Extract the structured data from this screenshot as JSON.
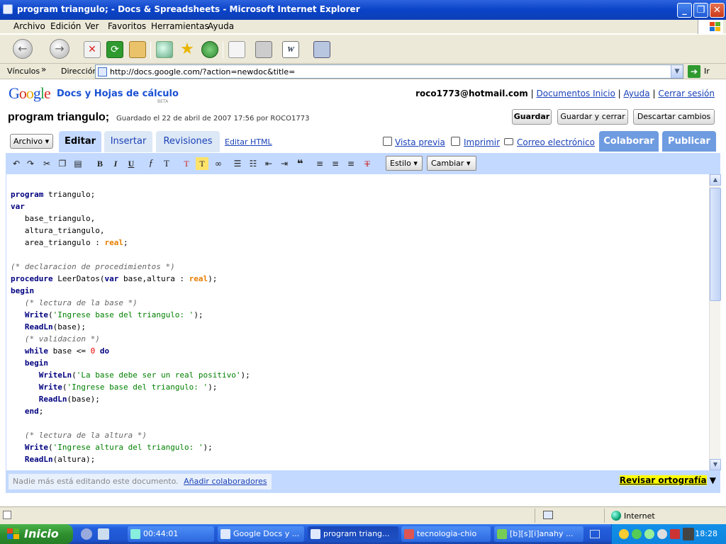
{
  "window": {
    "title": "program triangulo; - Docs & Spreadsheets - Microsoft Internet Explorer",
    "controls": {
      "minimize": "_",
      "restore": "❐",
      "close": "✕"
    }
  },
  "menu": [
    "Archivo",
    "Edición",
    "Ver",
    "Favoritos",
    "Herramientas",
    "Ayuda"
  ],
  "toolbar_icons": [
    "back-icon",
    "forward-icon",
    "stop-icon",
    "refresh-icon",
    "home-icon",
    "search-icon",
    "favorites-icon",
    "history-icon",
    "mail-icon",
    "print-icon",
    "word-icon",
    "research-icon"
  ],
  "address": {
    "links_label": "Vínculos",
    "chevron": "»",
    "label": "Dirección",
    "url": "http://docs.google.com/?action=newdoc&title=",
    "go_label": "Ir"
  },
  "app": {
    "logo": {
      "g1": "G",
      "o1": "o",
      "o2": "o",
      "g2": "g",
      "l": "l",
      "e": "e"
    },
    "product": "Docs y Hojas de cálculo",
    "beta": "BETA",
    "user_email": "roco1773@hotmail.com",
    "links": [
      "Documentos Inicio",
      "Ayuda",
      "Cerrar sesión"
    ],
    "separator": "|"
  },
  "doc": {
    "title": "program triangulo;",
    "saved": "Guardado el 22 de abril de 2007 17:56 por ROCO1773",
    "buttons": {
      "save": "Guardar",
      "save_close": "Guardar y cerrar",
      "discard": "Descartar cambios"
    }
  },
  "tabs": {
    "archivo": "Archivo",
    "editar": "Editar",
    "insertar": "Insertar",
    "revisiones": "Revisiones",
    "editar_html": "Editar HTML",
    "vista_previa": "Vista previa",
    "imprimir": "Imprimir",
    "correo": "Correo electrónico",
    "colaborar": "Colaborar",
    "publicar": "Publicar"
  },
  "format_toolbar": {
    "icons": [
      "undo-icon",
      "redo-icon",
      "cut-icon",
      "copy-icon",
      "paste-icon",
      "bold-icon",
      "italic-icon",
      "underline-icon",
      "font-icon",
      "font-size-icon",
      "text-color-icon",
      "highlight-icon",
      "link-icon",
      "numbered-list-icon",
      "bullet-list-icon",
      "outdent-icon",
      "indent-icon",
      "quote-icon",
      "align-left-icon",
      "align-center-icon",
      "align-right-icon",
      "clear-format-icon"
    ],
    "glyphs": {
      "bold": "B",
      "italic": "I",
      "underline": "U"
    },
    "style": "Estilo",
    "change": "Cambiar"
  },
  "code": {
    "l1a": "program",
    "l1b": " triangulo;",
    "l2": "var",
    "l3": "   base_triangulo,",
    "l4": "   altura_triangulo,",
    "l5a": "   area_triangulo : ",
    "l5b": "real",
    "l5c": ";",
    "l6": "(* declaracion de procedimientos *)",
    "l7a": "procedure",
    "l7b": " LeerDatos(",
    "l7c": "var",
    "l7d": " base,altura : ",
    "l7e": "real",
    "l7f": ");",
    "l8": "begin",
    "l9": "   (* lectura de la base *)",
    "l10a": "   ",
    "l10b": "Write",
    "l10c": "(",
    "l10d": "'Ingrese base del triangulo: '",
    "l10e": ");",
    "l11a": "   ",
    "l11b": "ReadLn",
    "l11c": "(base);",
    "l12": "   (* validacion *)",
    "l13a": "   ",
    "l13b": "while",
    "l13c": " base <= ",
    "l13d": "0",
    "l13e": " ",
    "l13f": "do",
    "l14a": "   ",
    "l14b": "begin",
    "l15a": "      ",
    "l15b": "WriteLn",
    "l15c": "(",
    "l15d": "'La base debe ser un real positivo'",
    "l15e": ");",
    "l16a": "      ",
    "l16b": "Write",
    "l16c": "(",
    "l16d": "'Ingrese base del triangulo: '",
    "l16e": ");",
    "l17a": "      ",
    "l17b": "ReadLn",
    "l17c": "(base);",
    "l18a": "   ",
    "l18b": "end",
    "l18c": ";",
    "l19": "   (* lectura de la altura *)",
    "l20a": "   ",
    "l20b": "Write",
    "l20c": "(",
    "l20d": "'Ingrese altura del triangulo: '",
    "l20e": ");",
    "l21a": "   ",
    "l21b": "ReadLn",
    "l21c": "(altura);"
  },
  "status": {
    "nadie": "Nadie más está editando este documento.",
    "add_collab": "Añadir colaboradores",
    "spell": "Revisar ortografía",
    "spell_arrow": "▼"
  },
  "ie_status": {
    "zone": "Internet"
  },
  "taskbar": {
    "start": "Inicio",
    "tasks": [
      "00:44:01",
      "Google Docs y ...",
      "program triang...",
      "tecnologia-chio",
      "[b][s][i]anahy ..."
    ],
    "clock": "18:28"
  },
  "colors": {
    "accent": "#c3d9ff",
    "link": "#1a41b8",
    "xp_blue": "#245edb"
  }
}
